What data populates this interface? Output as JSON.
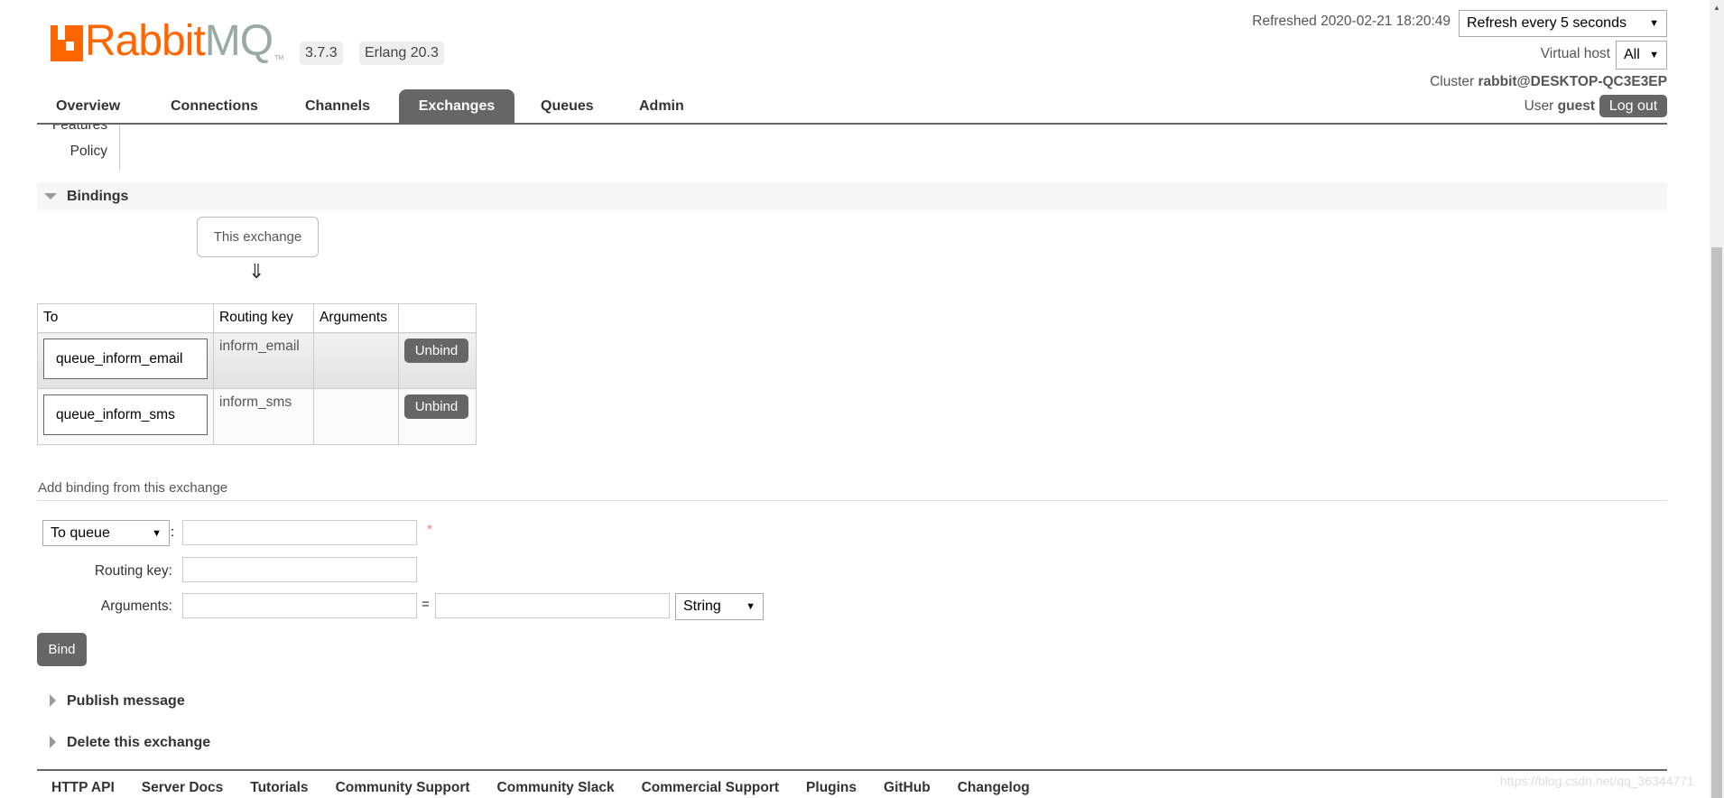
{
  "header": {
    "logo": {
      "brand": "Rabbit",
      "brand2": "MQ",
      "tm": "TM"
    },
    "version": "3.7.3",
    "erlang": "Erlang 20.3",
    "refreshed": "Refreshed 2020-02-21 18:20:49",
    "refresh_select": "Refresh every 5 seconds",
    "vhost_label": "Virtual host",
    "vhost_select": "All",
    "cluster_label": "Cluster",
    "cluster_name": "rabbit@DESKTOP-QC3E3EP",
    "user_label": "User",
    "user_name": "guest",
    "logout": "Log out"
  },
  "nav": {
    "tabs": [
      {
        "label": "Overview"
      },
      {
        "label": "Connections"
      },
      {
        "label": "Channels"
      },
      {
        "label": "Exchanges",
        "active": true
      },
      {
        "label": "Queues"
      },
      {
        "label": "Admin"
      }
    ]
  },
  "details": {
    "features": "Features",
    "policy": "Policy"
  },
  "bindings": {
    "title": "Bindings",
    "this_exchange": "This exchange",
    "arrow": "⇓",
    "columns": [
      "To",
      "Routing key",
      "Arguments",
      ""
    ],
    "rows": [
      {
        "to": "queue_inform_email",
        "routing_key": "inform_email",
        "arguments": "",
        "action": "Unbind"
      },
      {
        "to": "queue_inform_sms",
        "routing_key": "inform_sms",
        "arguments": "",
        "action": "Unbind"
      }
    ]
  },
  "add_binding": {
    "title": "Add binding from this exchange",
    "dest_type": "To queue",
    "colon": ":",
    "required": "*",
    "routing_key_label": "Routing key:",
    "arguments_label": "Arguments:",
    "equals": "=",
    "arg_type": "String",
    "bind": "Bind"
  },
  "sections": {
    "publish": "Publish message",
    "delete": "Delete this exchange"
  },
  "footer": {
    "links": [
      "HTTP API",
      "Server Docs",
      "Tutorials",
      "Community Support",
      "Community Slack",
      "Commercial Support",
      "Plugins",
      "GitHub",
      "Changelog"
    ]
  },
  "watermark": "https://blog.csdn.net/qq_36344771",
  "colors": {
    "brand": "#ff6600",
    "button": "#666666",
    "required": "#ff7777"
  }
}
